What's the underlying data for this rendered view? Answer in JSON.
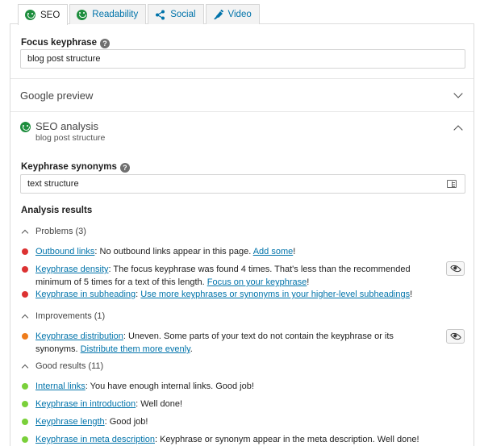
{
  "tabs": [
    {
      "label": "SEO",
      "icon": "smiley-icon",
      "active": true
    },
    {
      "label": "Readability",
      "icon": "smiley-icon",
      "active": false
    },
    {
      "label": "Social",
      "icon": "share-icon",
      "active": false
    },
    {
      "label": "Video",
      "icon": "video-icon",
      "active": false
    }
  ],
  "focus_keyphrase": {
    "label": "Focus keyphrase",
    "value": "blog post structure"
  },
  "google_preview": {
    "title": "Google preview"
  },
  "seo_analysis": {
    "title": "SEO analysis",
    "subtitle": "blog post structure"
  },
  "keyphrase_synonyms": {
    "label": "Keyphrase synonyms",
    "value": "text structure"
  },
  "analysis_results": {
    "title": "Analysis results",
    "problems": {
      "label": "Problems (3)",
      "items": [
        {
          "link": "Outbound links",
          "text": ": No outbound links appear in this page. ",
          "link2": "Add some",
          "tail": "!"
        },
        {
          "link": "Keyphrase density",
          "text": ": The focus keyphrase was found 4 times. That's less than the recommended minimum of 5 times for a text of this length. ",
          "link2": "Focus on your keyphrase",
          "tail": "!"
        },
        {
          "link": "Keyphrase in subheading",
          "text": ": ",
          "link2": "Use more keyphrases or synonyms in your higher-level subheadings",
          "tail": "!"
        }
      ]
    },
    "improvements": {
      "label": "Improvements (1)",
      "items": [
        {
          "link": "Keyphrase distribution",
          "text": ": Uneven. Some parts of your text do not contain the keyphrase or its synonyms. ",
          "link2": "Distribute them more evenly",
          "tail": "."
        }
      ]
    },
    "good": {
      "label": "Good results (11)",
      "items": [
        {
          "link": "Internal links",
          "text": ": You have enough internal links. Good job!"
        },
        {
          "link": "Keyphrase in introduction",
          "text": ": Well done!"
        },
        {
          "link": "Keyphrase length",
          "text": ": Good job!"
        },
        {
          "link": "Keyphrase in meta description",
          "text": ": Keyphrase or synonym appear in the meta description. Well done!"
        }
      ]
    }
  },
  "colors": {
    "problem": "#dc3232",
    "improvement": "#ee7c1b",
    "good": "#7ad03a",
    "link": "#0073aa",
    "smiley": "#1e8e3e"
  }
}
